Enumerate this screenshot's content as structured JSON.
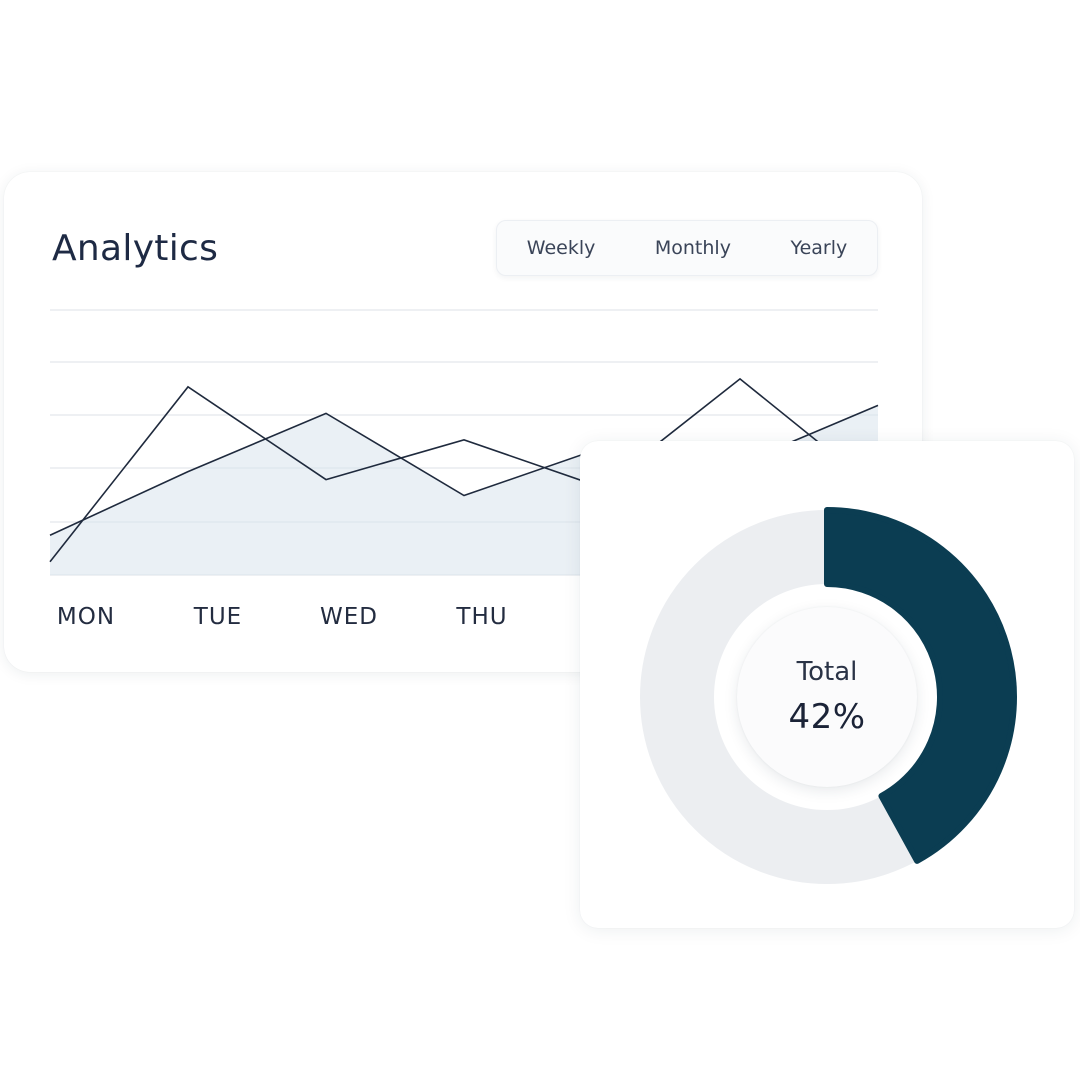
{
  "analytics": {
    "title": "Analytics",
    "periods": [
      "Weekly",
      "Monthly",
      "Yearly"
    ]
  },
  "colors": {
    "line": "#1f2a3d",
    "area": "#d9e3ec",
    "grid": "#e8ebef",
    "tick": "#232c40",
    "donut_accent": "#0b3d52",
    "donut_track": "#eceef1"
  },
  "chart_data": [
    {
      "type": "line",
      "categories": [
        "MON",
        "TUE",
        "WED",
        "THU"
      ],
      "grid": true,
      "series": [
        {
          "values": [
            0.05,
            0.71,
            0.36,
            0.51,
            0.33,
            0.74,
            0.32
          ]
        },
        {
          "values": [
            0.15,
            0.39,
            0.61,
            0.3,
            0.48,
            0.42,
            0.64
          ]
        }
      ]
    },
    {
      "type": "pie",
      "label": "Total",
      "value_text": "42%",
      "value": 42
    }
  ]
}
